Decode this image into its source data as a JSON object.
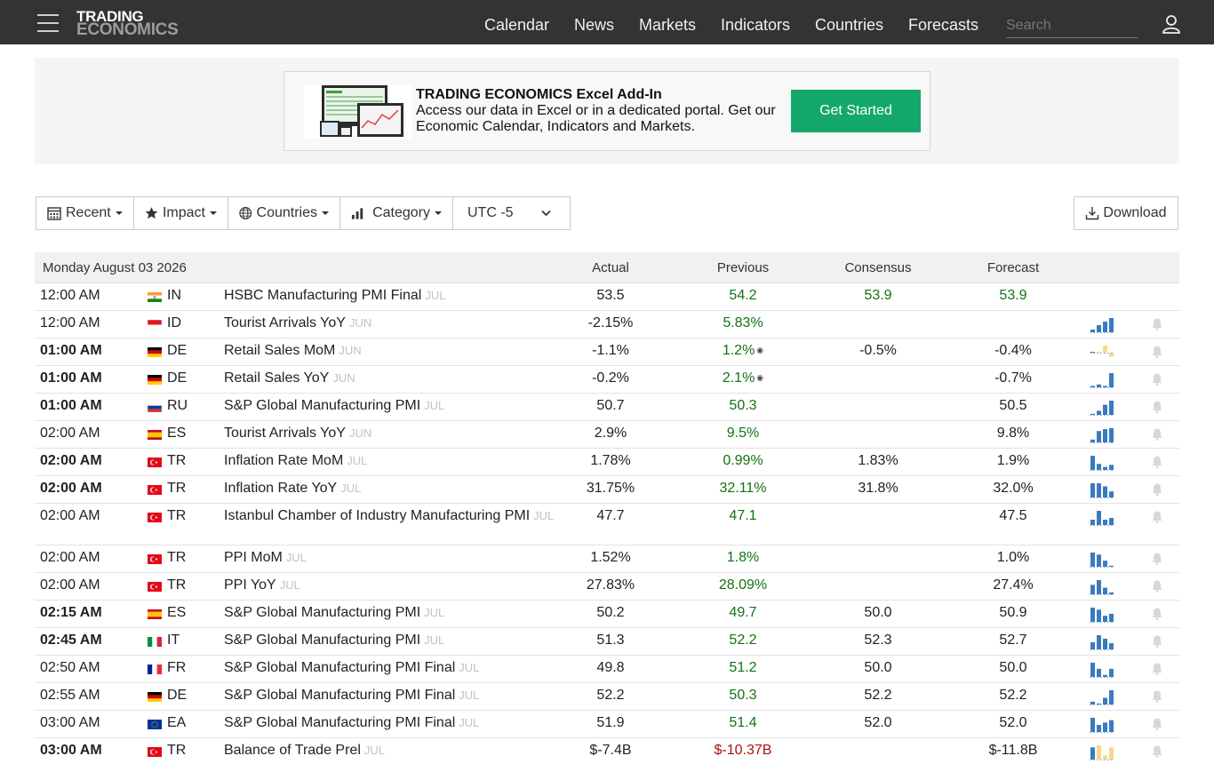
{
  "brand": {
    "line1": "TRADING",
    "line2": "ECONOMICS"
  },
  "nav": [
    "Calendar",
    "News",
    "Markets",
    "Indicators",
    "Countries",
    "Forecasts"
  ],
  "search": {
    "placeholder": "Search"
  },
  "banner": {
    "title": "TRADING ECONOMICS Excel Add-In",
    "text": "Access our data in Excel or in a dedicated portal. Get our Economic Calendar, Indicators and Markets.",
    "cta": "Get Started"
  },
  "filters": {
    "recent": "Recent",
    "impact": "Impact",
    "countries": "Countries",
    "category": "Category",
    "timezone": "UTC -5"
  },
  "download": "Download",
  "table": {
    "date": "Monday August 03 2026",
    "headers": {
      "actual": "Actual",
      "previous": "Previous",
      "consensus": "Consensus",
      "forecast": "Forecast"
    },
    "rows": [
      {
        "time": "12:00 AM",
        "bold": false,
        "country": "IN",
        "flag": "in",
        "event": "HSBC Manufacturing PMI Final",
        "ref": "JUL",
        "actual": "53.5",
        "previous": "54.2",
        "consensus": "53.9",
        "forecast": "53.9",
        "fc_green": true,
        "spark": []
      },
      {
        "time": "12:00 AM",
        "bold": false,
        "country": "ID",
        "flag": "id",
        "event": "Tourist Arrivals YoY",
        "ref": "JUN",
        "actual": "-2.15%",
        "previous": "5.83%",
        "consensus": "",
        "forecast": "",
        "spark": [
          3,
          8,
          12,
          16
        ]
      },
      {
        "time": "01:00 AM",
        "bold": true,
        "country": "DE",
        "flag": "de",
        "event": "Retail Sales MoM",
        "ref": "JUN",
        "actual": "-1.1%",
        "previous": "1.2%",
        "revised": true,
        "consensus": "-0.5%",
        "forecast": "-0.4%",
        "spark": [
          0,
          1,
          9,
          -5
        ],
        "spark_color": "#f5d98a"
      },
      {
        "time": "01:00 AM",
        "bold": true,
        "country": "DE",
        "flag": "de",
        "event": "Retail Sales YoY",
        "ref": "JUN",
        "actual": "-0.2%",
        "previous": "2.1%",
        "revised": true,
        "consensus": "",
        "forecast": "-0.7%",
        "spark": [
          1,
          2,
          1,
          10
        ]
      },
      {
        "time": "01:00 AM",
        "bold": true,
        "country": "RU",
        "flag": "ru",
        "event": "S&P Global Manufacturing PMI",
        "ref": "JUL",
        "actual": "50.7",
        "previous": "50.3",
        "consensus": "",
        "forecast": "50.5",
        "spark": [
          1,
          4,
          10,
          14
        ]
      },
      {
        "time": "02:00 AM",
        "bold": false,
        "country": "ES",
        "flag": "es",
        "event": "Tourist Arrivals YoY",
        "ref": "JUN",
        "actual": "2.9%",
        "previous": "9.5%",
        "consensus": "",
        "forecast": "9.8%",
        "spark": [
          3,
          12,
          14,
          15
        ]
      },
      {
        "time": "02:00 AM",
        "bold": true,
        "country": "TR",
        "flag": "tr",
        "event": "Inflation Rate MoM",
        "ref": "JUL",
        "actual": "1.78%",
        "previous": "0.99%",
        "consensus": "1.83%",
        "forecast": "1.9%",
        "spark": [
          14,
          6,
          3,
          5
        ]
      },
      {
        "time": "02:00 AM",
        "bold": true,
        "country": "TR",
        "flag": "tr",
        "event": "Inflation Rate YoY",
        "ref": "JUL",
        "actual": "31.75%",
        "previous": "32.11%",
        "consensus": "31.8%",
        "forecast": "32.0%",
        "spark": [
          14,
          14,
          11,
          6
        ]
      },
      {
        "time": "02:00 AM",
        "bold": false,
        "country": "TR",
        "flag": "tr",
        "event": "Istanbul Chamber of Industry Manufacturing PMI",
        "ref": "JUL",
        "tall": true,
        "actual": "47.7",
        "previous": "47.1",
        "consensus": "",
        "forecast": "47.5",
        "spark": [
          6,
          16,
          6,
          8
        ]
      },
      {
        "time": "02:00 AM",
        "bold": false,
        "country": "TR",
        "flag": "tr",
        "event": "PPI MoM",
        "ref": "JUL",
        "actual": "1.52%",
        "previous": "1.8%",
        "consensus": "",
        "forecast": "1.0%",
        "spark": [
          14,
          12,
          6,
          1
        ]
      },
      {
        "time": "02:00 AM",
        "bold": false,
        "country": "TR",
        "flag": "tr",
        "event": "PPI YoY",
        "ref": "JUL",
        "actual": "27.83%",
        "previous": "28.09%",
        "consensus": "",
        "forecast": "27.4%",
        "spark": [
          10,
          15,
          7,
          2
        ]
      },
      {
        "time": "02:15 AM",
        "bold": true,
        "country": "ES",
        "flag": "es",
        "event": "S&P Global Manufacturing PMI",
        "ref": "JUL",
        "actual": "50.2",
        "previous": "49.7",
        "consensus": "50.0",
        "forecast": "50.9",
        "spark": [
          14,
          12,
          6,
          8
        ]
      },
      {
        "time": "02:45 AM",
        "bold": true,
        "country": "IT",
        "flag": "it",
        "event": "S&P Global Manufacturing PMI",
        "ref": "JUL",
        "actual": "51.3",
        "previous": "52.2",
        "consensus": "52.3",
        "forecast": "52.7",
        "spark": [
          8,
          16,
          12,
          7
        ]
      },
      {
        "time": "02:50 AM",
        "bold": false,
        "country": "FR",
        "flag": "fr",
        "event": "S&P Global Manufacturing PMI Final",
        "ref": "JUL",
        "actual": "49.8",
        "previous": "51.2",
        "consensus": "50.0",
        "forecast": "50.0",
        "spark": [
          14,
          8,
          2,
          8
        ]
      },
      {
        "time": "02:55 AM",
        "bold": false,
        "country": "DE",
        "flag": "de",
        "event": "S&P Global Manufacturing PMI Final",
        "ref": "JUL",
        "actual": "52.2",
        "previous": "50.3",
        "consensus": "52.2",
        "forecast": "52.2",
        "spark": [
          3,
          1,
          7,
          15
        ]
      },
      {
        "time": "03:00 AM",
        "bold": false,
        "country": "EA",
        "flag": "ea",
        "event": "S&P Global Manufacturing PMI Final",
        "ref": "JUL",
        "actual": "51.9",
        "previous": "51.4",
        "consensus": "52.0",
        "forecast": "52.0",
        "spark": [
          12,
          6,
          8,
          10
        ]
      },
      {
        "time": "03:00 AM",
        "bold": true,
        "country": "TR",
        "flag": "tr",
        "event": "Balance of Trade Prel",
        "ref": "JUL",
        "actual": "$-7.4B",
        "previous": "$-10.37B",
        "prev_negative": true,
        "consensus": "",
        "forecast": "$-11.8B",
        "spark": [
          12,
          14,
          4,
          12
        ],
        "spark_color": "#f5d98a"
      }
    ]
  },
  "colors": {
    "topbar": "#333333",
    "accent": "#14a86a",
    "positive": "#117311",
    "negative": "#aa1111",
    "spark": "#3a7bbf"
  }
}
